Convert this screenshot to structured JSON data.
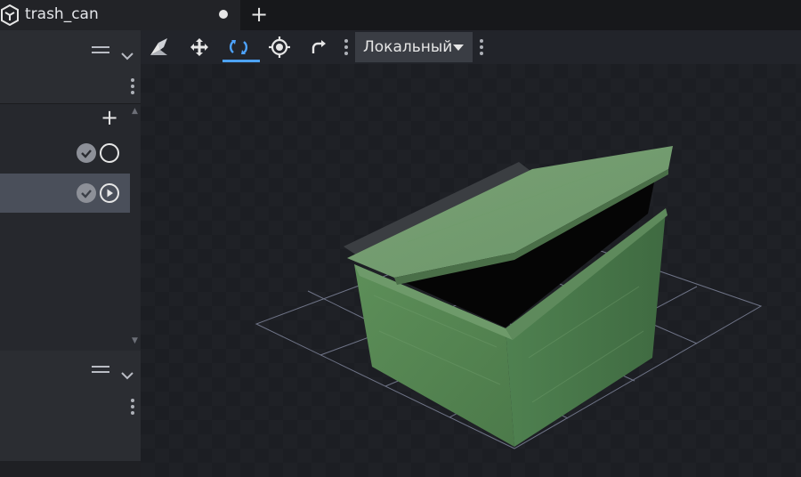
{
  "tab": {
    "title": "trash_can",
    "icon": "model-cube-icon",
    "modified": true,
    "add_label": "+"
  },
  "left_panel": {
    "add_label": "+",
    "items": [
      {
        "name": "",
        "visible": true,
        "icon": "circle-icon",
        "selected": false
      },
      {
        "name": "",
        "visible": true,
        "icon": "play-circle-icon",
        "selected": true
      }
    ]
  },
  "viewport_toolbar": {
    "tools": [
      {
        "name": "pivot-tool",
        "icon": "pivot-icon",
        "active": false
      },
      {
        "name": "move-tool",
        "icon": "move-arrows-icon",
        "active": false
      },
      {
        "name": "rotate-tool",
        "icon": "rotate-icon",
        "active": true
      },
      {
        "name": "center-tool",
        "icon": "target-icon",
        "active": false
      },
      {
        "name": "redo-tool",
        "icon": "redo-icon",
        "active": false
      }
    ],
    "space_select": {
      "value": "Локальный"
    }
  },
  "colors": {
    "accent": "#4da3ff",
    "viewport_bg": "#1b1d22",
    "panel_bg": "#26282d",
    "selected_row": "#4a4f5a",
    "box_green": "#5f8f5c",
    "grid_line": "#8a90a8"
  }
}
